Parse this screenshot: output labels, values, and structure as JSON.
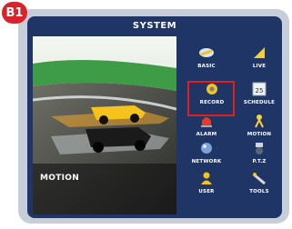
{
  "badge": "B1",
  "window": {
    "title": "SYSTEM"
  },
  "preview": {
    "label": "MOTION"
  },
  "menu": {
    "items": [
      {
        "label": "BASIC",
        "icon": "basic-icon"
      },
      {
        "label": "LIVE",
        "icon": "live-icon"
      },
      {
        "label": "RECORD",
        "icon": "record-icon",
        "selected": true
      },
      {
        "label": "SCHEDULE",
        "icon": "schedule-icon",
        "badge_text": "25"
      },
      {
        "label": "ALARM",
        "icon": "alarm-icon"
      },
      {
        "label": "MOTION",
        "icon": "motion-icon"
      },
      {
        "label": "NETWORK",
        "icon": "network-icon"
      },
      {
        "label": "P.T.Z",
        "icon": "ptz-icon"
      },
      {
        "label": "USER",
        "icon": "user-icon"
      },
      {
        "label": "TOOLS",
        "icon": "tools-icon"
      }
    ]
  },
  "colors": {
    "background": "#1f3566",
    "highlight": "#e02020"
  }
}
